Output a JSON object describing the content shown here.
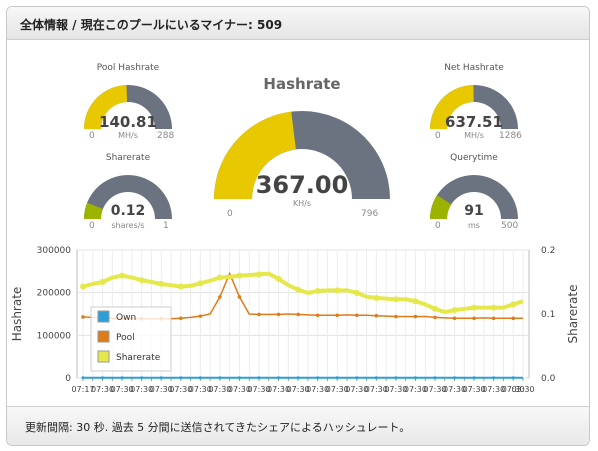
{
  "header": {
    "title": "全体情報 / 現在このプールにいるマイナー: 509"
  },
  "footer": {
    "text": "更新間隔: 30 秒. 過去 5 分間に送信されてきたシェアによるハッシュレート。"
  },
  "gauges": {
    "pool_hashrate": {
      "title": "Pool Hashrate",
      "value": "140.81",
      "unit": "MH/s",
      "min": "0",
      "max": "288",
      "fraction": 0.489
    },
    "sharerate": {
      "title": "Sharerate",
      "value": "0.12",
      "unit": "shares/s",
      "min": "0",
      "max": "1",
      "fraction": 0.12
    },
    "hashrate": {
      "title": "Hashrate",
      "value": "367.00",
      "unit": "KH/s",
      "min": "0",
      "max": "796",
      "fraction": 0.461
    },
    "net_hashrate": {
      "title": "Net Hashrate",
      "value": "637.51",
      "unit": "MH/s",
      "min": "0",
      "max": "1286",
      "fraction": 0.496
    },
    "querytime": {
      "title": "Querytime",
      "value": "91",
      "unit": "ms",
      "min": "0",
      "max": "500",
      "fraction": 0.182
    }
  },
  "colors": {
    "gauge_fill": "#e8c800",
    "gauge_fill_low": "#9cb300",
    "gauge_track": "#6b7380",
    "own": "#2b9fd8",
    "pool": "#e07b19",
    "sharerate": "#e5e84a"
  },
  "chart_data": {
    "type": "line",
    "ylabel": "Hashrate",
    "y2label": "Sharerate",
    "ylim": [
      0,
      300000
    ],
    "y2lim": [
      0,
      0.2
    ],
    "yticks": [
      "0",
      "100000",
      "200000",
      "300000"
    ],
    "y2ticks": [
      "0.0",
      "0.1",
      "0.2"
    ],
    "xticks": [
      "07:17",
      "07:30",
      "07:30",
      "07:30",
      "07:30",
      "07:30",
      "07:30",
      "07:30",
      "07:30",
      "07:30",
      "07:30",
      "07:30",
      "07:30",
      "07:30",
      "07:30",
      "07:30",
      "07:30",
      "07:30",
      "07:30",
      "07:30",
      "07:30",
      "07:30",
      "07:30",
      "07:30",
      "07:30",
      "07:30",
      "07:30",
      "07:30",
      "07:30",
      "07:30",
      "07:30",
      "07:30",
      "07:30",
      "07:30",
      "07:30",
      "07:30",
      "07:30",
      "07:30",
      "07:30",
      "07:30",
      "07:30",
      "07:30",
      "07:30",
      "07:30",
      "07:30",
      "03:30"
    ],
    "x": [
      0,
      1,
      2,
      3,
      4,
      5,
      6,
      7,
      8,
      9,
      10,
      11,
      12,
      13,
      14,
      15,
      16,
      17,
      18,
      19,
      20,
      21,
      22,
      23,
      24,
      25,
      26,
      27,
      28,
      29,
      30,
      31,
      32,
      33,
      34,
      35,
      36,
      37,
      38,
      39,
      40,
      41,
      42,
      43,
      44,
      45
    ],
    "series": [
      {
        "name": "Own",
        "axis": "left",
        "values": [
          500,
          500,
          500,
          500,
          500,
          500,
          500,
          500,
          500,
          500,
          500,
          500,
          500,
          500,
          500,
          500,
          500,
          500,
          500,
          500,
          500,
          500,
          500,
          500,
          500,
          500,
          500,
          500,
          500,
          500,
          500,
          500,
          500,
          500,
          500,
          500,
          500,
          500,
          500,
          500,
          500,
          500,
          500,
          500,
          500,
          500
        ]
      },
      {
        "name": "Pool",
        "axis": "left",
        "values": [
          143000,
          142000,
          141000,
          140000,
          140000,
          140000,
          139000,
          139000,
          139000,
          139000,
          140000,
          142000,
          145000,
          150000,
          190000,
          245000,
          190000,
          150000,
          149000,
          149000,
          149000,
          150000,
          149000,
          148000,
          147000,
          147000,
          147000,
          148000,
          147000,
          147000,
          146000,
          145000,
          144000,
          144000,
          144000,
          144000,
          142000,
          141000,
          140000,
          140000,
          140000,
          141000,
          140000,
          140000,
          140000,
          140000
        ]
      },
      {
        "name": "Sharerate",
        "axis": "right",
        "values": [
          0.143,
          0.147,
          0.15,
          0.157,
          0.16,
          0.157,
          0.153,
          0.15,
          0.147,
          0.145,
          0.143,
          0.144,
          0.148,
          0.152,
          0.157,
          0.158,
          0.16,
          0.161,
          0.162,
          0.163,
          0.155,
          0.145,
          0.138,
          0.133,
          0.136,
          0.137,
          0.137,
          0.137,
          0.133,
          0.127,
          0.125,
          0.124,
          0.123,
          0.123,
          0.12,
          0.115,
          0.108,
          0.103,
          0.106,
          0.108,
          0.11,
          0.11,
          0.11,
          0.11,
          0.115,
          0.12
        ]
      }
    ],
    "legend": {
      "position": "left-middle",
      "items": [
        "Own",
        "Pool",
        "Sharerate"
      ]
    },
    "grid": true
  }
}
